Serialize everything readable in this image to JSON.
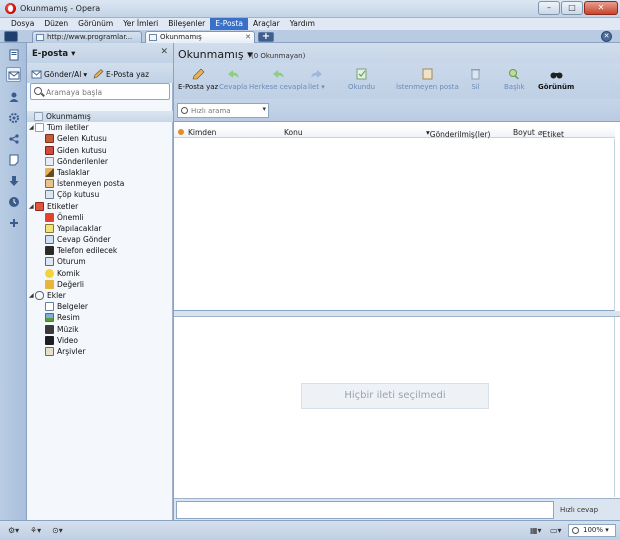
{
  "window": {
    "title": "Okunmamış - Opera"
  },
  "menu": [
    "Dosya",
    "Düzen",
    "Görünüm",
    "Yer İmleri",
    "Bileşenler",
    "E-Posta",
    "Araçlar",
    "Yardım"
  ],
  "tabs": [
    {
      "label": "http://www.programlar..."
    },
    {
      "label": "Okunmamış"
    }
  ],
  "mail_panel": {
    "title": "E-posta",
    "send_receive": "Gönder/Al",
    "compose": "E-Posta yaz",
    "search_placeholder": "Aramaya başla"
  },
  "tree": {
    "unread": "Okunmamış",
    "all_messages": "Tüm iletiler",
    "inbox": "Gelen Kutusu",
    "outbox": "Giden kutusu",
    "sent": "Gönderilenler",
    "drafts": "Taslaklar",
    "spam": "İstenmeyen posta",
    "trash": "Çöp kutusu",
    "labels": "Etiketler",
    "important": "Önemli",
    "todo": "Yapılacaklar",
    "send_reply": "Cevap Gönder",
    "call": "Telefon edilecek",
    "meeting": "Oturum",
    "funny": "Komik",
    "valuable": "Değerli",
    "attachments": "Ekler",
    "documents": "Belgeler",
    "images": "Resim",
    "music": "Müzik",
    "video": "Video",
    "archives": "Arşivler"
  },
  "main": {
    "title": "Okunmamış",
    "subtitle": "(0 Okunmayan)",
    "toolbar": {
      "compose": "E-Posta yaz",
      "reply": "Cevapla",
      "reply_all": "Herkese cevapla",
      "forward": "İlet",
      "read": "Okundu",
      "spam": "İstenmeyen posta",
      "delete": "Sil",
      "title": "Başlık",
      "view": "Görünüm"
    },
    "quick_search_placeholder": "Hızlı arama",
    "columns": {
      "from": "Kimden",
      "subject": "Konu",
      "sent": "Gönderilmiş(ler)",
      "size": "Boyut",
      "label": "Etiket"
    },
    "no_message": "Hiçbir ileti seçilmedi",
    "quick_reply": "Hızlı cevap"
  },
  "status": {
    "zoom": "100%"
  },
  "colors": {
    "accent": "#3a71c8",
    "panel": "#c1d2e6"
  }
}
